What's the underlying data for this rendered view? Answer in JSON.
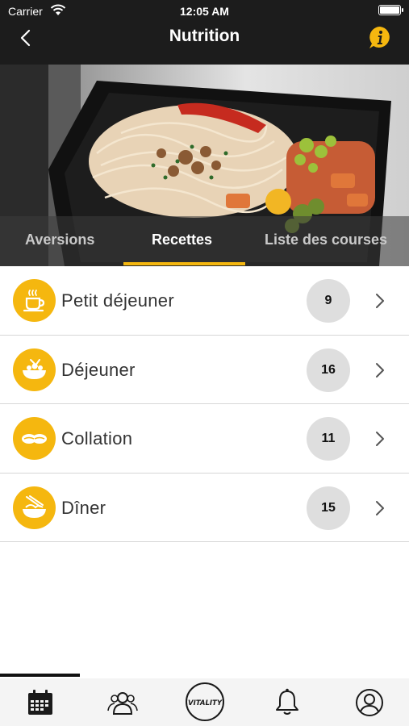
{
  "status_bar": {
    "carrier": "Carrier",
    "time": "12:05 AM"
  },
  "nav": {
    "title": "Nutrition"
  },
  "tabs": [
    {
      "label": "Aversions",
      "active": false
    },
    {
      "label": "Recettes",
      "active": true
    },
    {
      "label": "Liste des courses",
      "active": false
    }
  ],
  "categories": [
    {
      "label": "Petit déjeuner",
      "count": "9",
      "icon": "coffee-cup-icon"
    },
    {
      "label": "Déjeuner",
      "count": "16",
      "icon": "lunch-bowl-icon"
    },
    {
      "label": "Collation",
      "count": "11",
      "icon": "snack-icon"
    },
    {
      "label": "Dîner",
      "count": "15",
      "icon": "noodle-bowl-icon"
    }
  ],
  "bottom_tabs": [
    {
      "name": "calendar-icon"
    },
    {
      "name": "community-icon"
    },
    {
      "name": "vitality-logo",
      "text": "VITALITY"
    },
    {
      "name": "bell-icon"
    },
    {
      "name": "profile-icon"
    }
  ],
  "colors": {
    "accent": "#f5b70f",
    "nav_bg": "#1c1c1c",
    "count_badge": "#dedede"
  }
}
